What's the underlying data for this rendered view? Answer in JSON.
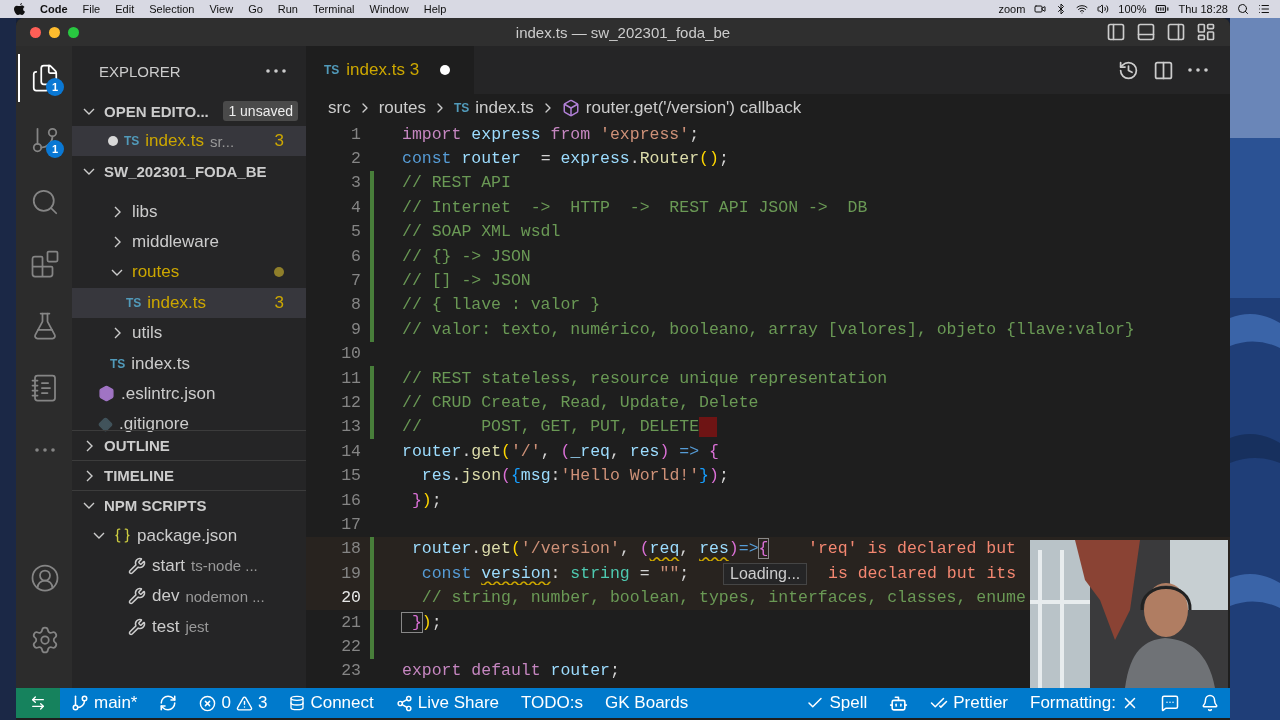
{
  "menubar": {
    "app": "Code",
    "items": [
      "File",
      "Edit",
      "Selection",
      "View",
      "Go",
      "Run",
      "Terminal",
      "Window",
      "Help"
    ],
    "zoom": "zoom",
    "battery": "100%",
    "clock": "Thu 18:28"
  },
  "window": {
    "title": "index.ts — sw_202301_foda_be"
  },
  "activity_bar": {
    "items": [
      {
        "kind": "files",
        "selected": true,
        "badge": "1"
      },
      {
        "kind": "source-control",
        "selected": false,
        "badge": "1"
      },
      {
        "kind": "search",
        "selected": false
      },
      {
        "kind": "extensions",
        "selected": false
      },
      {
        "kind": "testing",
        "selected": false
      },
      {
        "kind": "notebook",
        "selected": false
      },
      {
        "kind": "more",
        "selected": false
      }
    ],
    "bottom": [
      {
        "kind": "account"
      },
      {
        "kind": "settings"
      }
    ]
  },
  "sidebar": {
    "title": "EXPLORER",
    "open_editors": {
      "label": "OPEN EDITO...",
      "expanded": true,
      "badge": "1 unsaved",
      "items": [
        {
          "file_icon": "TS",
          "name": "index.ts",
          "path": "sr...",
          "problems": "3",
          "modified": true
        }
      ]
    },
    "project": {
      "label": "SW_202301_FODA_BE",
      "expanded": true,
      "children": [
        {
          "kind": "continued",
          "children": [
            {
              "kind": "folder",
              "name": "libs",
              "expanded": false
            },
            {
              "kind": "folder",
              "name": "middleware",
              "expanded": false
            },
            {
              "kind": "folder",
              "name": "routes",
              "expanded": true,
              "modified": true,
              "children": [
                {
                  "kind": "ts",
                  "file_icon": "TS",
                  "name": "index.ts",
                  "selected": true,
                  "problems": "3"
                }
              ]
            },
            {
              "kind": "folder",
              "name": "utils",
              "expanded": false
            },
            {
              "kind": "ts",
              "file_icon": "TS",
              "name": "index.ts",
              "selected": false
            }
          ]
        },
        {
          "kind": "eslint",
          "name": ".eslintrc.json",
          "selected": false
        },
        {
          "kind": "git",
          "name": ".gitignore",
          "selected": false
        }
      ]
    },
    "sections": [
      {
        "label": "OUTLINE",
        "expanded": false
      },
      {
        "label": "TIMELINE",
        "expanded": false
      }
    ],
    "npm_scripts": {
      "label": "NPM SCRIPTS",
      "expanded": true,
      "children": [
        {
          "name": "package.json",
          "expanded": true,
          "scripts": [
            {
              "name": "start",
              "command": "ts-node ..."
            },
            {
              "name": "dev",
              "command": "nodemon ..."
            },
            {
              "name": "test",
              "command": "jest"
            }
          ]
        }
      ]
    }
  },
  "editor": {
    "tabs": [
      {
        "file_icon": "TS",
        "name": "index.ts",
        "problems": "3",
        "modified": true,
        "selected": true
      }
    ],
    "breadcrumbs": [
      {
        "kind": "folder",
        "label": "src"
      },
      {
        "kind": "folder",
        "label": "routes"
      },
      {
        "kind": "ts",
        "file_icon": "TS",
        "label": "index.ts"
      },
      {
        "kind": "symbol",
        "label": "router.get('/version') callback"
      }
    ],
    "lines": [
      {
        "number": "1",
        "tokens": [
          {
            "text": "import",
            "kind": "kw"
          },
          {
            "text": " express ",
            "kind": "var"
          },
          {
            "text": "from",
            "kind": "kw"
          },
          {
            "text": " 'express'",
            "kind": "str"
          },
          {
            "text": ";",
            "kind": "plain"
          }
        ]
      },
      {
        "number": "2",
        "tokens": [
          {
            "text": "const",
            "kind": "storage"
          },
          {
            "text": " router",
            "kind": "var"
          },
          {
            "text": "  = ",
            "kind": "plain"
          },
          {
            "text": "express",
            "kind": "var"
          },
          {
            "text": ".",
            "kind": "plain"
          },
          {
            "text": "Router",
            "kind": "fn"
          },
          {
            "text": "()",
            "kind": "bracket"
          },
          {
            "text": ";",
            "kind": "plain"
          }
        ]
      },
      {
        "number": "3",
        "changed": true,
        "tokens": [
          {
            "text": "// REST API",
            "kind": "comment"
          }
        ]
      },
      {
        "number": "4",
        "changed": true,
        "tokens": [
          {
            "text": "// Internet  ->  HTTP  ->  REST API JSON ->  DB",
            "kind": "comment"
          }
        ]
      },
      {
        "number": "5",
        "changed": true,
        "tokens": [
          {
            "text": "// SOAP XML wsdl",
            "kind": "comment"
          }
        ]
      },
      {
        "number": "6",
        "changed": true,
        "tokens": [
          {
            "text": "// {} -> JSON",
            "kind": "comment"
          }
        ]
      },
      {
        "number": "7",
        "changed": true,
        "tokens": [
          {
            "text": "// [] -> JSON",
            "kind": "comment"
          }
        ]
      },
      {
        "number": "8",
        "changed": true,
        "tokens": [
          {
            "text": "// { llave : valor }",
            "kind": "comment"
          }
        ]
      },
      {
        "number": "9",
        "changed": true,
        "tokens": [
          {
            "text": "// valor: texto, numérico, booleano, array [valores], objeto {llave:valor}",
            "kind": "comment"
          }
        ]
      },
      {
        "number": "10"
      },
      {
        "number": "11",
        "changed": true,
        "tokens": [
          {
            "text": "// REST stateless, resource unique representation",
            "kind": "comment"
          }
        ]
      },
      {
        "number": "12",
        "changed": true,
        "tokens": [
          {
            "text": "// CRUD Create, Read, Update, Delete",
            "kind": "comment"
          }
        ]
      },
      {
        "number": "13",
        "changed": true,
        "trailing_mark": true,
        "tokens": [
          {
            "text": "//      POST, GET, PUT, DELETE",
            "kind": "comment"
          }
        ]
      },
      {
        "number": "14",
        "tokens": [
          {
            "text": "router",
            "kind": "var"
          },
          {
            "text": ".",
            "kind": "plain"
          },
          {
            "text": "get",
            "kind": "fn"
          },
          {
            "text": "(",
            "kind": "bracket"
          },
          {
            "text": "'/'",
            "kind": "str"
          },
          {
            "text": ", ",
            "kind": "plain"
          },
          {
            "text": "(",
            "kind": "bracket2"
          },
          {
            "text": "_req",
            "kind": "var"
          },
          {
            "text": ", ",
            "kind": "plain"
          },
          {
            "text": "res",
            "kind": "var"
          },
          {
            "text": ")",
            "kind": "bracket2"
          },
          {
            "text": " => ",
            "kind": "storage"
          },
          {
            "text": "{",
            "kind": "bracket2"
          }
        ]
      },
      {
        "number": "15",
        "tokens": [
          {
            "text": "  res",
            "kind": "var"
          },
          {
            "text": ".",
            "kind": "plain"
          },
          {
            "text": "json",
            "kind": "fn"
          },
          {
            "text": "(",
            "kind": "bracket2"
          },
          {
            "text": "{",
            "kind": "bracket3"
          },
          {
            "text": "msg",
            "kind": "var"
          },
          {
            "text": ":",
            "kind": "plain"
          },
          {
            "text": "'Hello World!'",
            "kind": "str"
          },
          {
            "text": "}",
            "kind": "bracket3"
          },
          {
            "text": ")",
            "kind": "bracket2"
          },
          {
            "text": ";",
            "kind": "plain"
          }
        ]
      },
      {
        "number": "16",
        "tokens": [
          {
            "text": " }",
            "kind": "bracket2"
          },
          {
            "text": ")",
            "kind": "bracket"
          },
          {
            "text": ";",
            "kind": "plain"
          }
        ]
      },
      {
        "number": "17"
      },
      {
        "number": "18",
        "changed": true,
        "highlighted": true,
        "diagnostic": "'req' is declared but",
        "tokens": [
          {
            "text": " router",
            "kind": "var"
          },
          {
            "text": ".",
            "kind": "plain"
          },
          {
            "text": "get",
            "kind": "fn"
          },
          {
            "text": "(",
            "kind": "bracket"
          },
          {
            "text": "'/version'",
            "kind": "str"
          },
          {
            "text": ", ",
            "kind": "plain"
          },
          {
            "text": "(",
            "kind": "bracket2"
          },
          {
            "text": "req",
            "kind": "var-err"
          },
          {
            "text": ", ",
            "kind": "plain"
          },
          {
            "text": "res",
            "kind": "var-err"
          },
          {
            "text": ")",
            "kind": "bracket2"
          },
          {
            "text": "=>",
            "kind": "storage"
          },
          {
            "text": "{",
            "kind": "match"
          }
        ]
      },
      {
        "number": "19",
        "changed": true,
        "highlighted": true,
        "diagnostic": "is declared but its",
        "hover": "Loading...",
        "tokens": [
          {
            "text": "  const ",
            "kind": "storage"
          },
          {
            "text": "version",
            "kind": "var-err"
          },
          {
            "text": ": ",
            "kind": "plain"
          },
          {
            "text": "string",
            "kind": "type"
          },
          {
            "text": " = ",
            "kind": "plain"
          },
          {
            "text": "\"\"",
            "kind": "str"
          },
          {
            "text": ";",
            "kind": "plain"
          }
        ]
      },
      {
        "number": "20",
        "changed": true,
        "highlighted": true,
        "current": true,
        "tokens": [
          {
            "text": "  // string, number, boolean, types, interfaces, classes, enume",
            "kind": "comment"
          }
        ]
      },
      {
        "number": "21",
        "changed": true,
        "tokens": [
          {
            "text": " }",
            "kind": "match"
          },
          {
            "text": ")",
            "kind": "bracket"
          },
          {
            "text": ";",
            "kind": "plain"
          }
        ]
      },
      {
        "number": "22",
        "changed": true
      },
      {
        "number": "23",
        "tokens": [
          {
            "text": "export",
            "kind": "kw"
          },
          {
            "text": " default ",
            "kind": "kw"
          },
          {
            "text": "router",
            "kind": "var"
          },
          {
            "text": ";",
            "kind": "plain"
          }
        ]
      }
    ]
  },
  "status_bar": {
    "left": [
      {
        "kind": "remote"
      },
      {
        "kind": "branch",
        "label": "main*"
      },
      {
        "kind": "sync"
      },
      {
        "kind": "problems",
        "errors": "0",
        "warnings": "3"
      },
      {
        "kind": "connect",
        "label": "Connect"
      },
      {
        "kind": "liveshare",
        "label": "Live Share"
      },
      {
        "kind": "text",
        "label": "TODO:s"
      },
      {
        "kind": "text",
        "label": "GK Boards"
      }
    ],
    "right": [
      {
        "kind": "spell",
        "label": "Spell"
      },
      {
        "kind": "copilot"
      },
      {
        "kind": "prettier",
        "label": "Prettier"
      },
      {
        "kind": "formatting",
        "label": "Formatting:"
      },
      {
        "kind": "feedback"
      },
      {
        "kind": "bell"
      }
    ]
  }
}
